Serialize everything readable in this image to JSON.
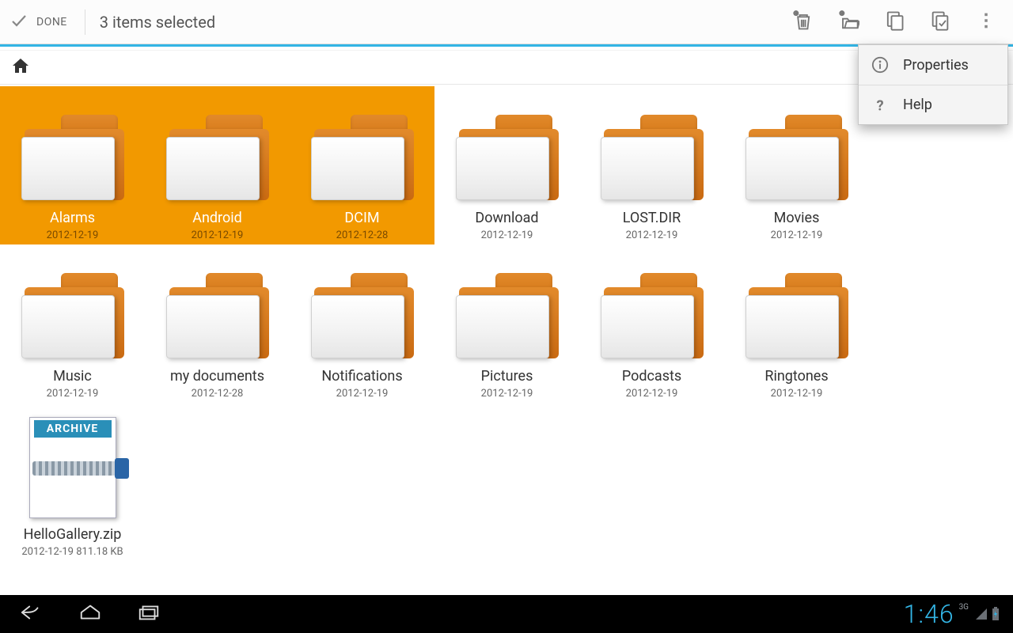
{
  "actionbar": {
    "done_label": "DONE",
    "title": "3 items selected"
  },
  "popup": {
    "items": [
      {
        "label": "Properties"
      },
      {
        "label": "Help"
      }
    ]
  },
  "files": [
    {
      "name": "Alarms",
      "date": "2012-12-19",
      "type": "folder",
      "selected": true
    },
    {
      "name": "Android",
      "date": "2012-12-19",
      "type": "folder",
      "selected": true
    },
    {
      "name": "DCIM",
      "date": "2012-12-28",
      "type": "folder",
      "selected": true
    },
    {
      "name": "Download",
      "date": "2012-12-19",
      "type": "folder",
      "selected": false
    },
    {
      "name": "LOST.DIR",
      "date": "2012-12-19",
      "type": "folder",
      "selected": false
    },
    {
      "name": "Movies",
      "date": "2012-12-19",
      "type": "folder",
      "selected": false
    },
    {
      "name": "Music",
      "date": "2012-12-19",
      "type": "folder",
      "selected": false
    },
    {
      "name": "my documents",
      "date": "2012-12-28",
      "type": "folder",
      "selected": false
    },
    {
      "name": "Notifications",
      "date": "2012-12-19",
      "type": "folder",
      "selected": false
    },
    {
      "name": "Pictures",
      "date": "2012-12-19",
      "type": "folder",
      "selected": false
    },
    {
      "name": "Podcasts",
      "date": "2012-12-19",
      "type": "folder",
      "selected": false
    },
    {
      "name": "Ringtones",
      "date": "2012-12-19",
      "type": "folder",
      "selected": false
    },
    {
      "name": "HelloGallery.zip",
      "date": "2012-12-19  811.18 KB",
      "type": "archive",
      "selected": false,
      "archive_badge": "ARCHIVE"
    }
  ],
  "status": {
    "clock": "1:46",
    "network_label": "3G"
  }
}
